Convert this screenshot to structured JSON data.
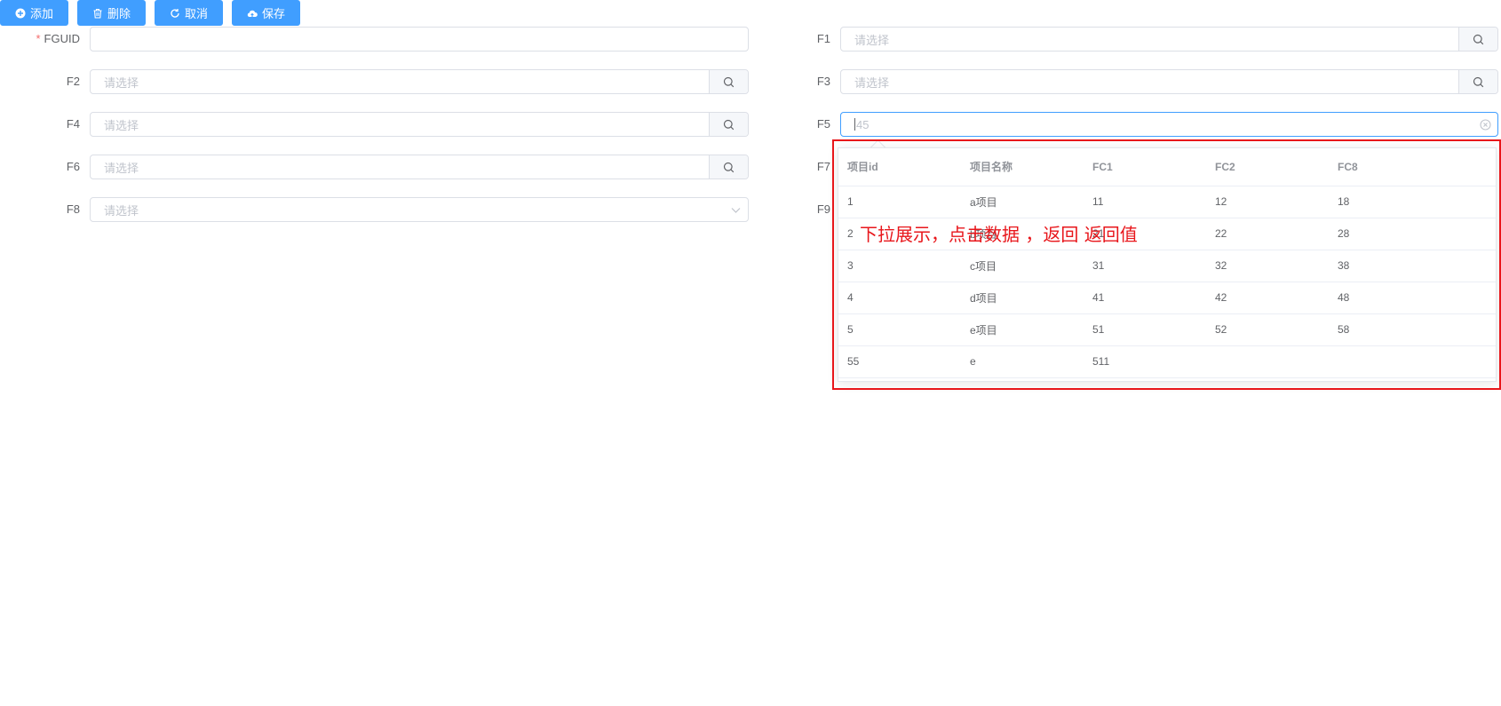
{
  "toolbar": {
    "add_label": "添加",
    "delete_label": "删除",
    "cancel_label": "取消",
    "save_label": "保存",
    "color": "#409eff"
  },
  "form": {
    "fguid": {
      "label": "FGUID",
      "required_mark": "*",
      "value": ""
    },
    "placeholder": "请选择",
    "f1": {
      "label": "F1"
    },
    "f2": {
      "label": "F2"
    },
    "f3": {
      "label": "F3"
    },
    "f4": {
      "label": "F4"
    },
    "f5": {
      "label": "F5",
      "value": "45"
    },
    "f6": {
      "label": "F6"
    },
    "f7": {
      "label": "F7"
    },
    "f8": {
      "label": "F8"
    },
    "f9": {
      "label": "F9"
    }
  },
  "dropdown_table": {
    "columns": [
      "项目id",
      "项目名称",
      "FC1",
      "FC2",
      "FC8"
    ],
    "rows": [
      [
        "1",
        "a项目",
        "11",
        "12",
        "18"
      ],
      [
        "2",
        "b项目",
        "21",
        "22",
        "28"
      ],
      [
        "3",
        "c项目",
        "31",
        "32",
        "38"
      ],
      [
        "4",
        "d项目",
        "41",
        "42",
        "48"
      ],
      [
        "5",
        "e项目",
        "51",
        "52",
        "58"
      ],
      [
        "55",
        "e",
        "511",
        "",
        ""
      ]
    ]
  },
  "annotation": {
    "text": "下拉展示，点击数据 ，返回 返回值",
    "color": "#e8161b"
  }
}
